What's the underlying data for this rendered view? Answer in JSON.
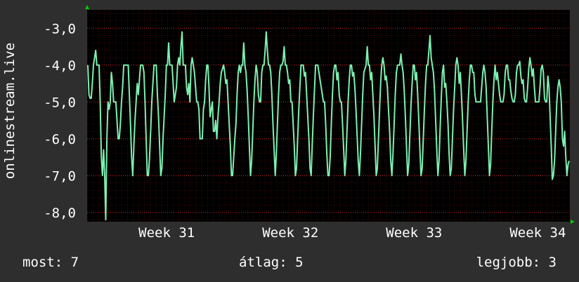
{
  "chart_data": {
    "type": "line",
    "ylabel": "onlinestream.live",
    "ylim": [
      -8.25,
      -2.5
    ],
    "yticks": [
      {
        "value": -3,
        "label": "-3,0"
      },
      {
        "value": -4,
        "label": "-4,0"
      },
      {
        "value": -5,
        "label": "-5,0"
      },
      {
        "value": -6,
        "label": "-6,0"
      },
      {
        "value": -7,
        "label": "-7,0"
      },
      {
        "value": -8,
        "label": "-8,0"
      }
    ],
    "xlim": [
      0,
      437
    ],
    "xticks": [
      {
        "value": 72,
        "label": "Week 31"
      },
      {
        "value": 184,
        "label": "Week 32"
      },
      {
        "value": 296,
        "label": "Week 33"
      },
      {
        "value": 408,
        "label": "Week 34"
      }
    ],
    "grid": true,
    "colors": {
      "line": "#7cf0b0",
      "grid": "#ff2a2a",
      "plot_bg": "#000000",
      "background": "#2e2e2e",
      "axis_arrow": "#00cc00"
    },
    "series": [
      {
        "values": [
          -4,
          -4.8,
          -4.9,
          -4.9,
          -4.5,
          -4,
          -3.8,
          -3.6,
          -4,
          -4,
          -4,
          -5,
          -6.5,
          -7,
          -6.3,
          -7,
          -8.2,
          -6,
          -5,
          -5.2,
          -5,
          -4.2,
          -4.5,
          -5,
          -5,
          -5,
          -5.5,
          -6,
          -6,
          -5.6,
          -5,
          -4.6,
          -4,
          -4,
          -4,
          -4,
          -4,
          -4.8,
          -5.6,
          -6.5,
          -7,
          -6.2,
          -5.5,
          -5,
          -4.5,
          -4.8,
          -4.4,
          -4,
          -4,
          -4,
          -4.2,
          -5,
          -6,
          -7,
          -7,
          -6.5,
          -5.8,
          -5,
          -4.5,
          -4,
          -4,
          -4,
          -4.8,
          -5.4,
          -6.2,
          -7,
          -6.8,
          -6,
          -5.4,
          -4.8,
          -4,
          -4,
          -3.4,
          -4,
          -4,
          -4,
          -4.5,
          -5,
          -4.8,
          -4.6,
          -4,
          -3.8,
          -4,
          -3.5,
          -3.1,
          -4,
          -4,
          -4,
          -4.6,
          -4.8,
          -4.5,
          -5,
          -4,
          -3.8,
          -4,
          -4.2,
          -4.6,
          -5,
          -5,
          -5.2,
          -6,
          -6,
          -6,
          -5.2,
          -5,
          -4.4,
          -4,
          -4,
          -4.6,
          -5.4,
          -5.2,
          -5,
          -5.8,
          -5.8,
          -5.5,
          -6,
          -5.4,
          -5,
          -4.5,
          -4.2,
          -4.1,
          -4,
          -4.2,
          -4.5,
          -4.4,
          -5,
          -5.6,
          -6.2,
          -7,
          -7,
          -6.5,
          -6,
          -5.6,
          -4.8,
          -4.2,
          -4,
          -4.2,
          -4,
          -4,
          -3.4,
          -4,
          -4.2,
          -4.7,
          -5.4,
          -6.2,
          -7,
          -6.6,
          -5.8,
          -5,
          -4.4,
          -4,
          -4.2,
          -4.8,
          -5,
          -5,
          -4.2,
          -4,
          -4,
          -3.6,
          -3.1,
          -3.6,
          -4,
          -4,
          -4.2,
          -4.8,
          -5.6,
          -6.3,
          -7,
          -6.4,
          -5.6,
          -4.8,
          -4.2,
          -4,
          -4,
          -3.9,
          -3.5,
          -4,
          -4,
          -4.2,
          -4.5,
          -4.4,
          -5,
          -5,
          -5.6,
          -6.2,
          -7,
          -6.8,
          -6,
          -5.2,
          -4.6,
          -4,
          -4,
          -4,
          -4.3,
          -4.2,
          -4.8,
          -5.4,
          -6,
          -6.8,
          -7,
          -6.2,
          -5.4,
          -4.7,
          -4,
          -4,
          -4,
          -4.2,
          -4.4,
          -4.6,
          -4.8,
          -5,
          -5,
          -5.6,
          -6.4,
          -7,
          -7,
          -6.5,
          -5.6,
          -4.8,
          -4.2,
          -4,
          -4,
          -4.4,
          -4.2,
          -4.8,
          -5,
          -5,
          -5.6,
          -6.3,
          -7,
          -6.6,
          -5.8,
          -5,
          -4.4,
          -4,
          -4,
          -4.3,
          -4.2,
          -4.6,
          -5.2,
          -5.9,
          -6.6,
          -7,
          -6.4,
          -5.6,
          -4.8,
          -4.2,
          -4.1,
          -4,
          -3.5,
          -4,
          -4,
          -4.4,
          -4.2,
          -4.8,
          -5.4,
          -6.2,
          -7,
          -6.8,
          -6,
          -5.2,
          -4.5,
          -4,
          -3.8,
          -4,
          -4.4,
          -4.3,
          -4.6,
          -5.2,
          -5.8,
          -6.6,
          -7,
          -6.4,
          -5.6,
          -4.8,
          -4.2,
          -4,
          -4,
          -4,
          -3.7,
          -4,
          -4.2,
          -4.7,
          -5.4,
          -6.2,
          -7,
          -6.7,
          -5.9,
          -5.1,
          -4.5,
          -4,
          -4,
          -4.4,
          -4.2,
          -4.8,
          -5.5,
          -6.3,
          -7,
          -6.8,
          -6,
          -5.2,
          -4.5,
          -4,
          -4,
          -3.6,
          -3.2,
          -3.8,
          -4,
          -4.2,
          -4.7,
          -5.5,
          -6.3,
          -7,
          -6.6,
          -5.7,
          -4.9,
          -4.2,
          -4,
          -4.6,
          -4.5,
          -5,
          -5.6,
          -6.4,
          -7,
          -6.8,
          -6,
          -5.2,
          -4.6,
          -4,
          -3.8,
          -4,
          -4.5,
          -4.2,
          -4.8,
          -5.5,
          -6.3,
          -7,
          -6.6,
          -5.8,
          -5,
          -4.4,
          -4,
          -4,
          -4.2,
          -4.2,
          -4.8,
          -5,
          -5,
          -5,
          -5,
          -5,
          -4.6,
          -4.2,
          -4,
          -4.2,
          -4.6,
          -5.4,
          -6.2,
          -7,
          -6.7,
          -5.8,
          -5,
          -4.4,
          -4,
          -4.4,
          -4.2,
          -4.5,
          -4.8,
          -5,
          -5,
          -5,
          -4.8,
          -4.2,
          -4,
          -4,
          -4.4,
          -4.4,
          -4.7,
          -4.9,
          -5,
          -5,
          -4.8,
          -4.2,
          -4,
          -4,
          -3.9,
          -4.3,
          -4.5,
          -4.4,
          -4.9,
          -5,
          -5,
          -4.6,
          -4.1,
          -3.8,
          -4,
          -4.3,
          -4.1,
          -4.6,
          -5,
          -5,
          -5,
          -5,
          -4.6,
          -4.1,
          -4,
          -4.2,
          -4.9,
          -5,
          -5,
          -4.3,
          -4.6,
          -5.4,
          -6.2,
          -7.1,
          -7,
          -6.6,
          -5.8,
          -5,
          -4.6,
          -4.4,
          -4.6,
          -5,
          -6,
          -6.2,
          -5.8,
          -6.5,
          -7,
          -6.7,
          -6.6
        ]
      }
    ]
  },
  "stats": {
    "current": "most: 7",
    "average": "átlag: 5",
    "best": "legjobb: 3"
  }
}
